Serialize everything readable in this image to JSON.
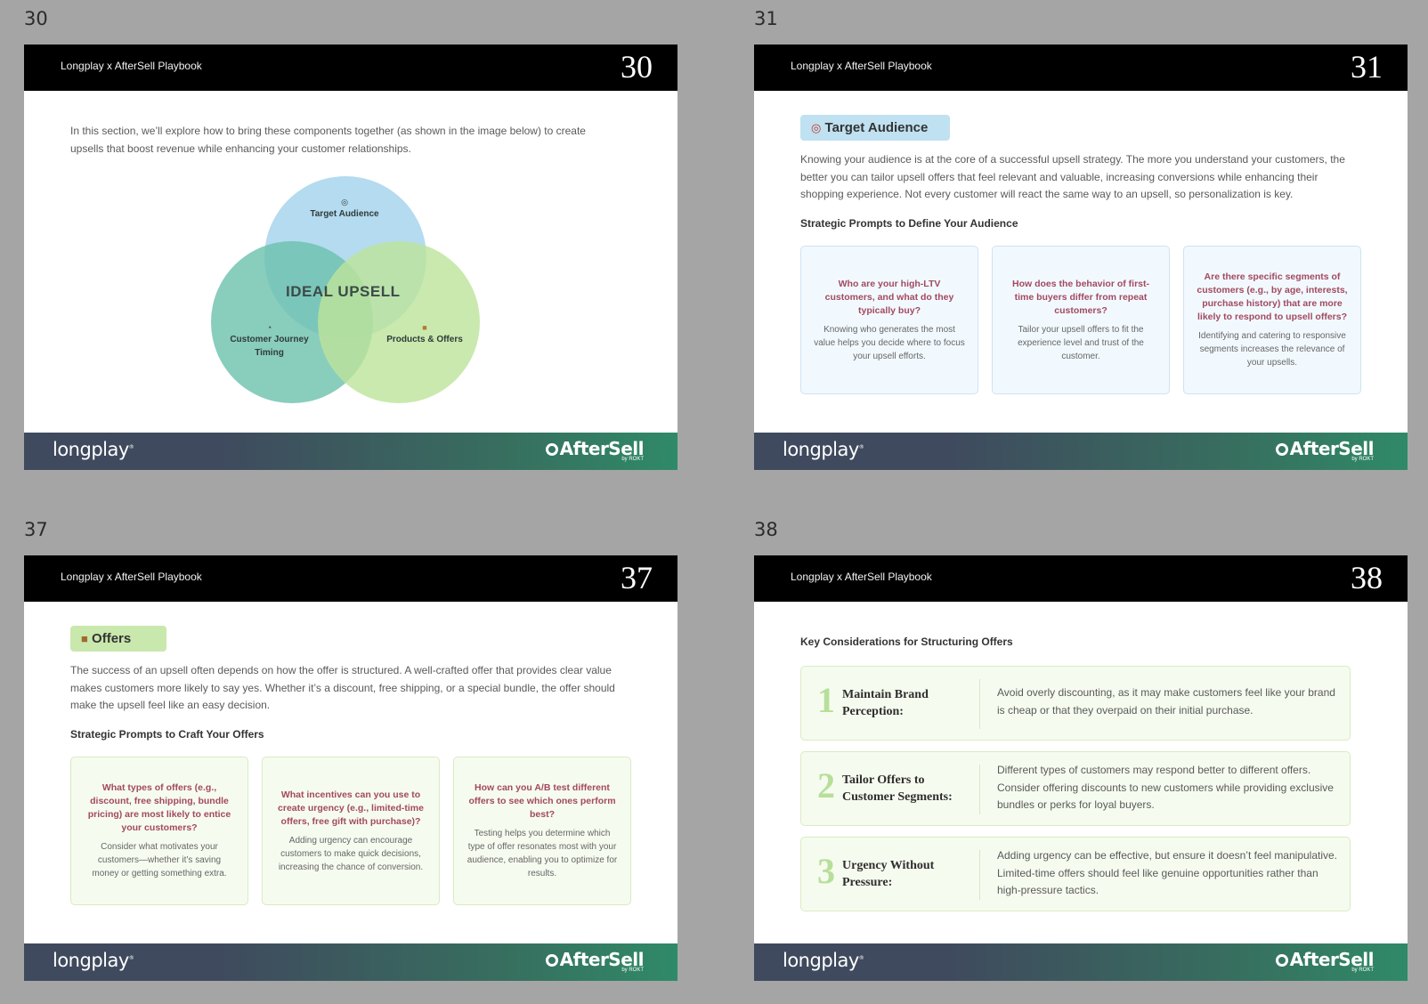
{
  "pages": [
    {
      "label": "30",
      "header": "Longplay x AfterSell Playbook",
      "number": "30"
    },
    {
      "label": "31",
      "header": "Longplay x AfterSell Playbook",
      "number": "31"
    },
    {
      "label": "37",
      "header": "Longplay x AfterSell Playbook",
      "number": "37"
    },
    {
      "label": "38",
      "header": "Longplay x AfterSell Playbook",
      "number": "38"
    }
  ],
  "footer": {
    "left_logo": "longplay",
    "left_logo_mark": "®",
    "right_logo": "AfterSell",
    "right_logo_sub": "by ROKT"
  },
  "slide30": {
    "intro": "In this section, we’ll explore how to bring these components together (as shown in the image below) to create upsells that boost revenue while enhancing your customer relationships.",
    "venn": {
      "center": "IDEAL UPSELL",
      "target": "Target Audience",
      "timing": "Customer Journey Timing",
      "products": "Products & Offers",
      "colors": {
        "target": "#a7d5ec",
        "timing": "#6cc1ad",
        "products": "#bde39a"
      }
    }
  },
  "slide31": {
    "pill": "Target Audience",
    "pill_icon": "target-icon",
    "intro": "Knowing your audience is at the core of a successful upsell strategy. The more you understand your customers, the better you can tailor upsell offers that feel relevant and valuable, increasing conversions while enhancing their shopping experience. Not every customer will react the same way to an upsell, so personalization is key.",
    "subheading": "Strategic Prompts to Define Your Audience",
    "cards": [
      {
        "q": "Who are your high-LTV customers, and what do they typically buy?",
        "a": "Knowing who generates the most value helps you decide where to focus your upsell efforts."
      },
      {
        "q": "How does the behavior of first-time buyers differ from repeat customers?",
        "a": "Tailor your upsell offers to fit the experience level and trust of the customer."
      },
      {
        "q": "Are there specific segments of customers (e.g., by age, interests, purchase history) that are more likely to respond to upsell offers?",
        "a": "Identifying and catering to responsive segments increases the relevance of your upsells."
      }
    ]
  },
  "slide37": {
    "pill": "Offers",
    "pill_icon": "package-icon",
    "intro": "The success of an upsell often depends on how the offer is structured. A well-crafted offer that provides clear value makes customers more likely to say yes. Whether it’s a discount, free shipping, or a special bundle, the offer should make the upsell feel like an easy decision.",
    "subheading": "Strategic Prompts to Craft Your Offers",
    "cards": [
      {
        "q": "What types of offers (e.g., discount, free shipping, bundle pricing) are most likely to entice your customers?",
        "a": "Consider what motivates your customers—whether it’s saving money or getting something extra."
      },
      {
        "q": "What incentives can you use to create urgency (e.g., limited-time offers, free gift with purchase)?",
        "a": "Adding urgency can encourage customers to make quick decisions, increasing the chance of conversion."
      },
      {
        "q": "How can you A/B test different offers to see which ones perform best?",
        "a": "Testing helps you determine which type of offer resonates most with your audience, enabling you to optimize for results."
      }
    ]
  },
  "slide38": {
    "subheading": "Key Considerations for Structuring Offers",
    "items": [
      {
        "num": "1",
        "title": "Maintain Brand Perception:",
        "desc": "Avoid overly discounting, as it may make customers feel like your brand is cheap or that they overpaid on their initial purchase."
      },
      {
        "num": "2",
        "title": "Tailor Offers to Customer Segments:",
        "desc": "Different types of customers may respond better to different offers. Consider offering discounts to new customers while providing exclusive bundles or perks for loyal buyers."
      },
      {
        "num": "3",
        "title": "Urgency Without Pressure:",
        "desc": "Adding urgency can be effective, but ensure it doesn’t feel manipulative. Limited-time offers should feel like genuine opportunities rather than high-pressure tactics."
      }
    ]
  }
}
